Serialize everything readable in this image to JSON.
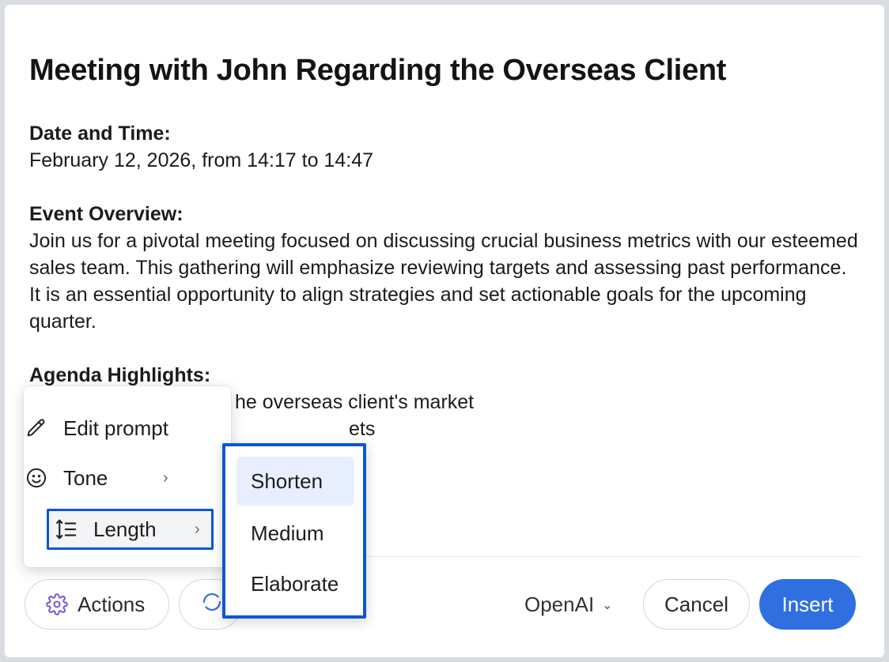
{
  "dialog": {
    "title": "Meeting with John Regarding the Overseas Client",
    "date_heading": "Date and Time:",
    "date_value": "February 12, 2026, from 14:17 to 14:47",
    "overview_heading": "Event Overview:",
    "overview_text": "Join us for a pivotal meeting focused on discussing crucial business metrics with our esteemed sales team. This gathering will emphasize reviewing targets and assessing past performance. It is an essential opportunity to align strategies and set actionable goals for the upcoming quarter.",
    "agenda_heading": "Agenda Highlights:",
    "agenda_items": [
      "he overseas client's market",
      "ets"
    ]
  },
  "footer": {
    "actions_label": "Actions",
    "provider_label": "OpenAI",
    "cancel_label": "Cancel",
    "insert_label": "Insert"
  },
  "menu": {
    "items": [
      {
        "label": "Edit prompt",
        "icon": "pencil-icon"
      },
      {
        "label": "Tone",
        "icon": "smiley-icon"
      },
      {
        "label": "Length",
        "icon": "length-icon"
      }
    ]
  },
  "submenu": {
    "items": [
      "Shorten",
      "Medium",
      "Elaborate"
    ]
  },
  "colors": {
    "accent": "#2f6fe0",
    "focus_outline": "#0b57d0",
    "highlight": "#e7efff",
    "icon_purple": "#7b5cd6"
  }
}
